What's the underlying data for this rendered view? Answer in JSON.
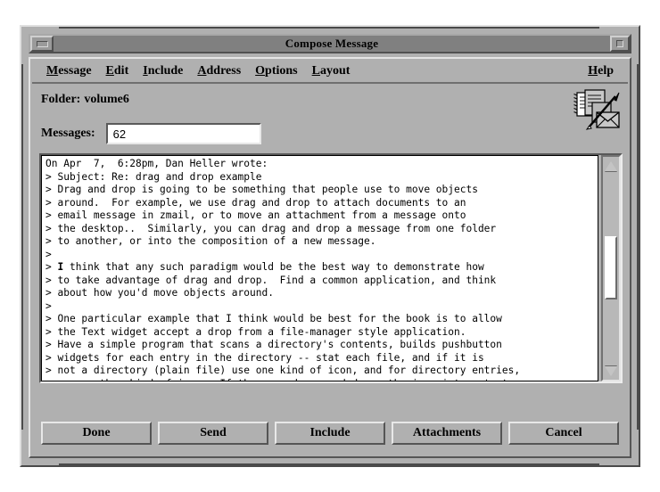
{
  "window": {
    "title": "Compose Message",
    "minimize_icon": "minimize-box-icon",
    "maximize_icon": "maximize-box-icon"
  },
  "menubar": {
    "items": [
      {
        "label": "Message",
        "mnemonic": "M",
        "rest": "essage"
      },
      {
        "label": "Edit",
        "mnemonic": "E",
        "rest": "dit"
      },
      {
        "label": "Include",
        "mnemonic": "I",
        "rest": "nclude"
      },
      {
        "label": "Address",
        "mnemonic": "A",
        "rest": "ddress"
      },
      {
        "label": "Options",
        "mnemonic": "O",
        "rest": "ptions"
      },
      {
        "label": "Layout",
        "mnemonic": "L",
        "rest": "ayout"
      }
    ],
    "help": {
      "label": "Help",
      "mnemonic": "H",
      "rest": "elp"
    }
  },
  "folder": {
    "label": "Folder:",
    "value": "volume6"
  },
  "messages": {
    "label": "Messages:",
    "value": "62",
    "placeholder": ""
  },
  "compose_icon": "compose-message-icon",
  "editor": {
    "header_line": "On Apr  7,  6:28pm, Dan Heller wrote:",
    "lines": [
      "> Subject: Re: drag and drop example",
      "> Drag and drop is going to be something that people use to move objects",
      "> around.  For example, we use drag and drop to attach documents to an",
      "> email message in zmail, or to move an attachment from a message onto",
      "> the desktop..  Similarly, you can drag and drop a message from one folder",
      "> to another, or into the composition of a new message.",
      ">",
      "> I think that any such paradigm would be the best way to demonstrate how",
      "> to take advantage of drag and drop.  Find a common application, and think",
      "> about how you'd move objects around.",
      ">",
      "> One particular example that I think would be best for the book is to allow",
      "> the Text widget accept a drop from a file-manager style application.",
      "> Have a simple program that scans a directory's contents, builds pushbutton",
      "> widgets for each entry in the directory -- stat each file, and if it is",
      "> not a directory (plain file) use one kind of icon, and for directory entries,",
      "> use another kind of icon.  If the user drags and drops the icon into a text"
    ],
    "bold_word": "I",
    "bold_line_index": 7
  },
  "scrollbar": {
    "up_arrow": "scroll-up-arrow-icon",
    "down_arrow": "scroll-down-arrow-icon",
    "thumb_top_percent": 33,
    "thumb_height_percent": 33
  },
  "buttons": [
    {
      "label": "Done",
      "name": "done-button"
    },
    {
      "label": "Send",
      "name": "send-button"
    },
    {
      "label": "Include",
      "name": "include-button"
    },
    {
      "label": "Attachments",
      "name": "attachments-button"
    },
    {
      "label": "Cancel",
      "name": "cancel-button"
    }
  ],
  "colors": {
    "window_bg": "#b0b0b0",
    "titlebar_bg": "#808080",
    "text_bg": "#ffffff",
    "text_fg": "#000000",
    "shadow": "#555555",
    "highlight": "#e8e8e8"
  }
}
